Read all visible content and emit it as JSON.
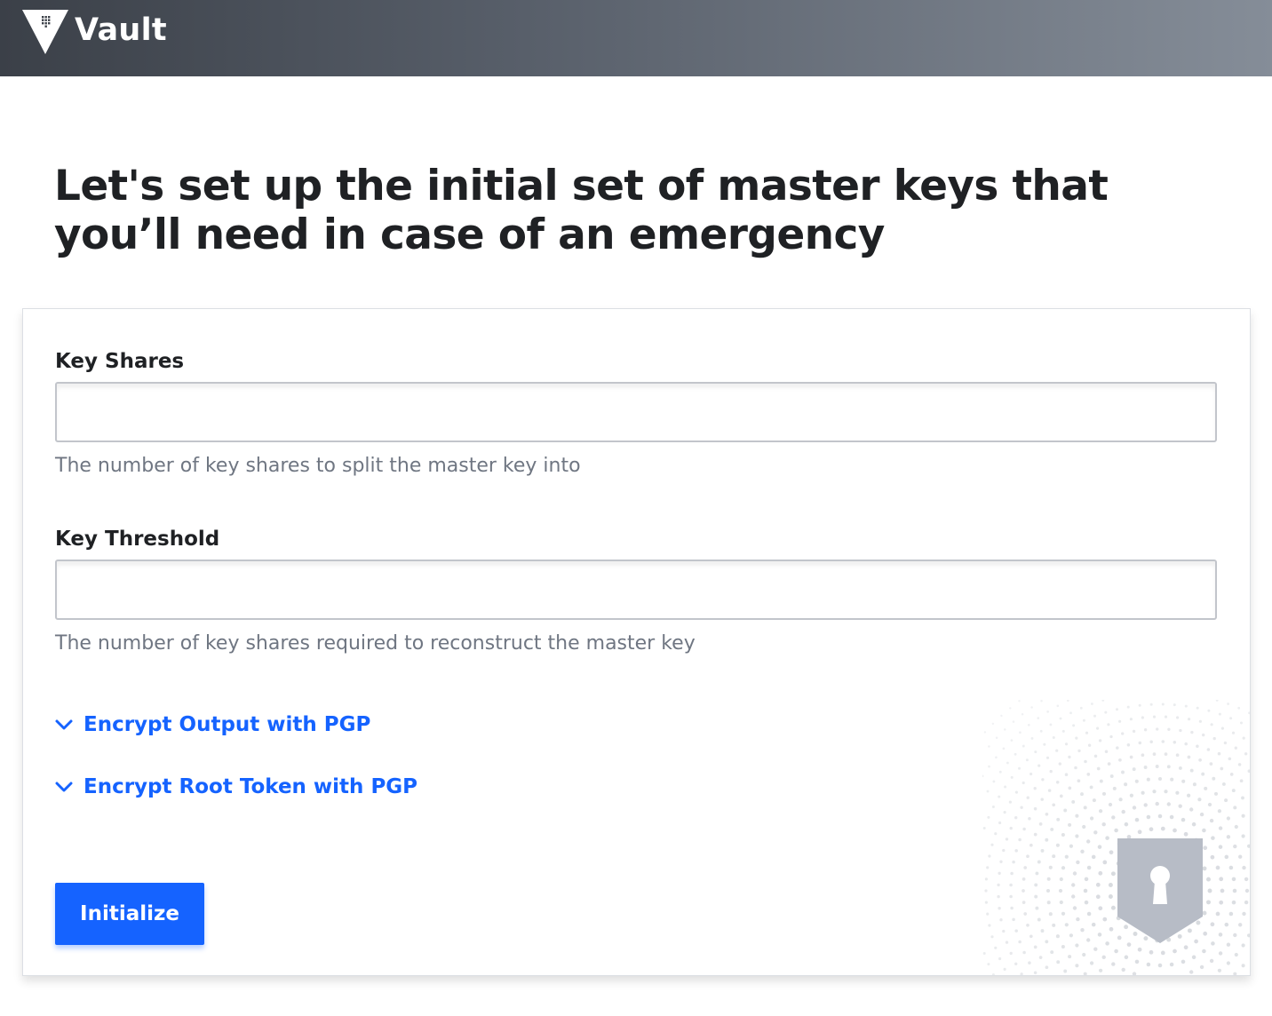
{
  "header": {
    "app_name": "Vault",
    "logo_icon": "vault-triangle-icon"
  },
  "page": {
    "title": "Let's set up the initial set of master keys that you’ll need in case of an emergency"
  },
  "form": {
    "key_shares": {
      "label": "Key Shares",
      "value": "",
      "placeholder": "",
      "help": "The number of key shares to split the master key into"
    },
    "key_threshold": {
      "label": "Key Threshold",
      "value": "",
      "placeholder": "",
      "help": "The number of key shares required to reconstruct the master key"
    },
    "toggles": [
      {
        "label": "Encrypt Output with PGP",
        "icon": "chevron-down-icon"
      },
      {
        "label": "Encrypt Root Token with PGP",
        "icon": "chevron-down-icon"
      }
    ],
    "submit_label": "Initialize"
  },
  "illustration": {
    "icon": "shield-keyhole-icon"
  },
  "colors": {
    "accent": "#1563ff",
    "header_dark": "#3b4048",
    "header_light": "#858d98",
    "help_text": "#6f7682",
    "shield": "#b7bcc6"
  }
}
